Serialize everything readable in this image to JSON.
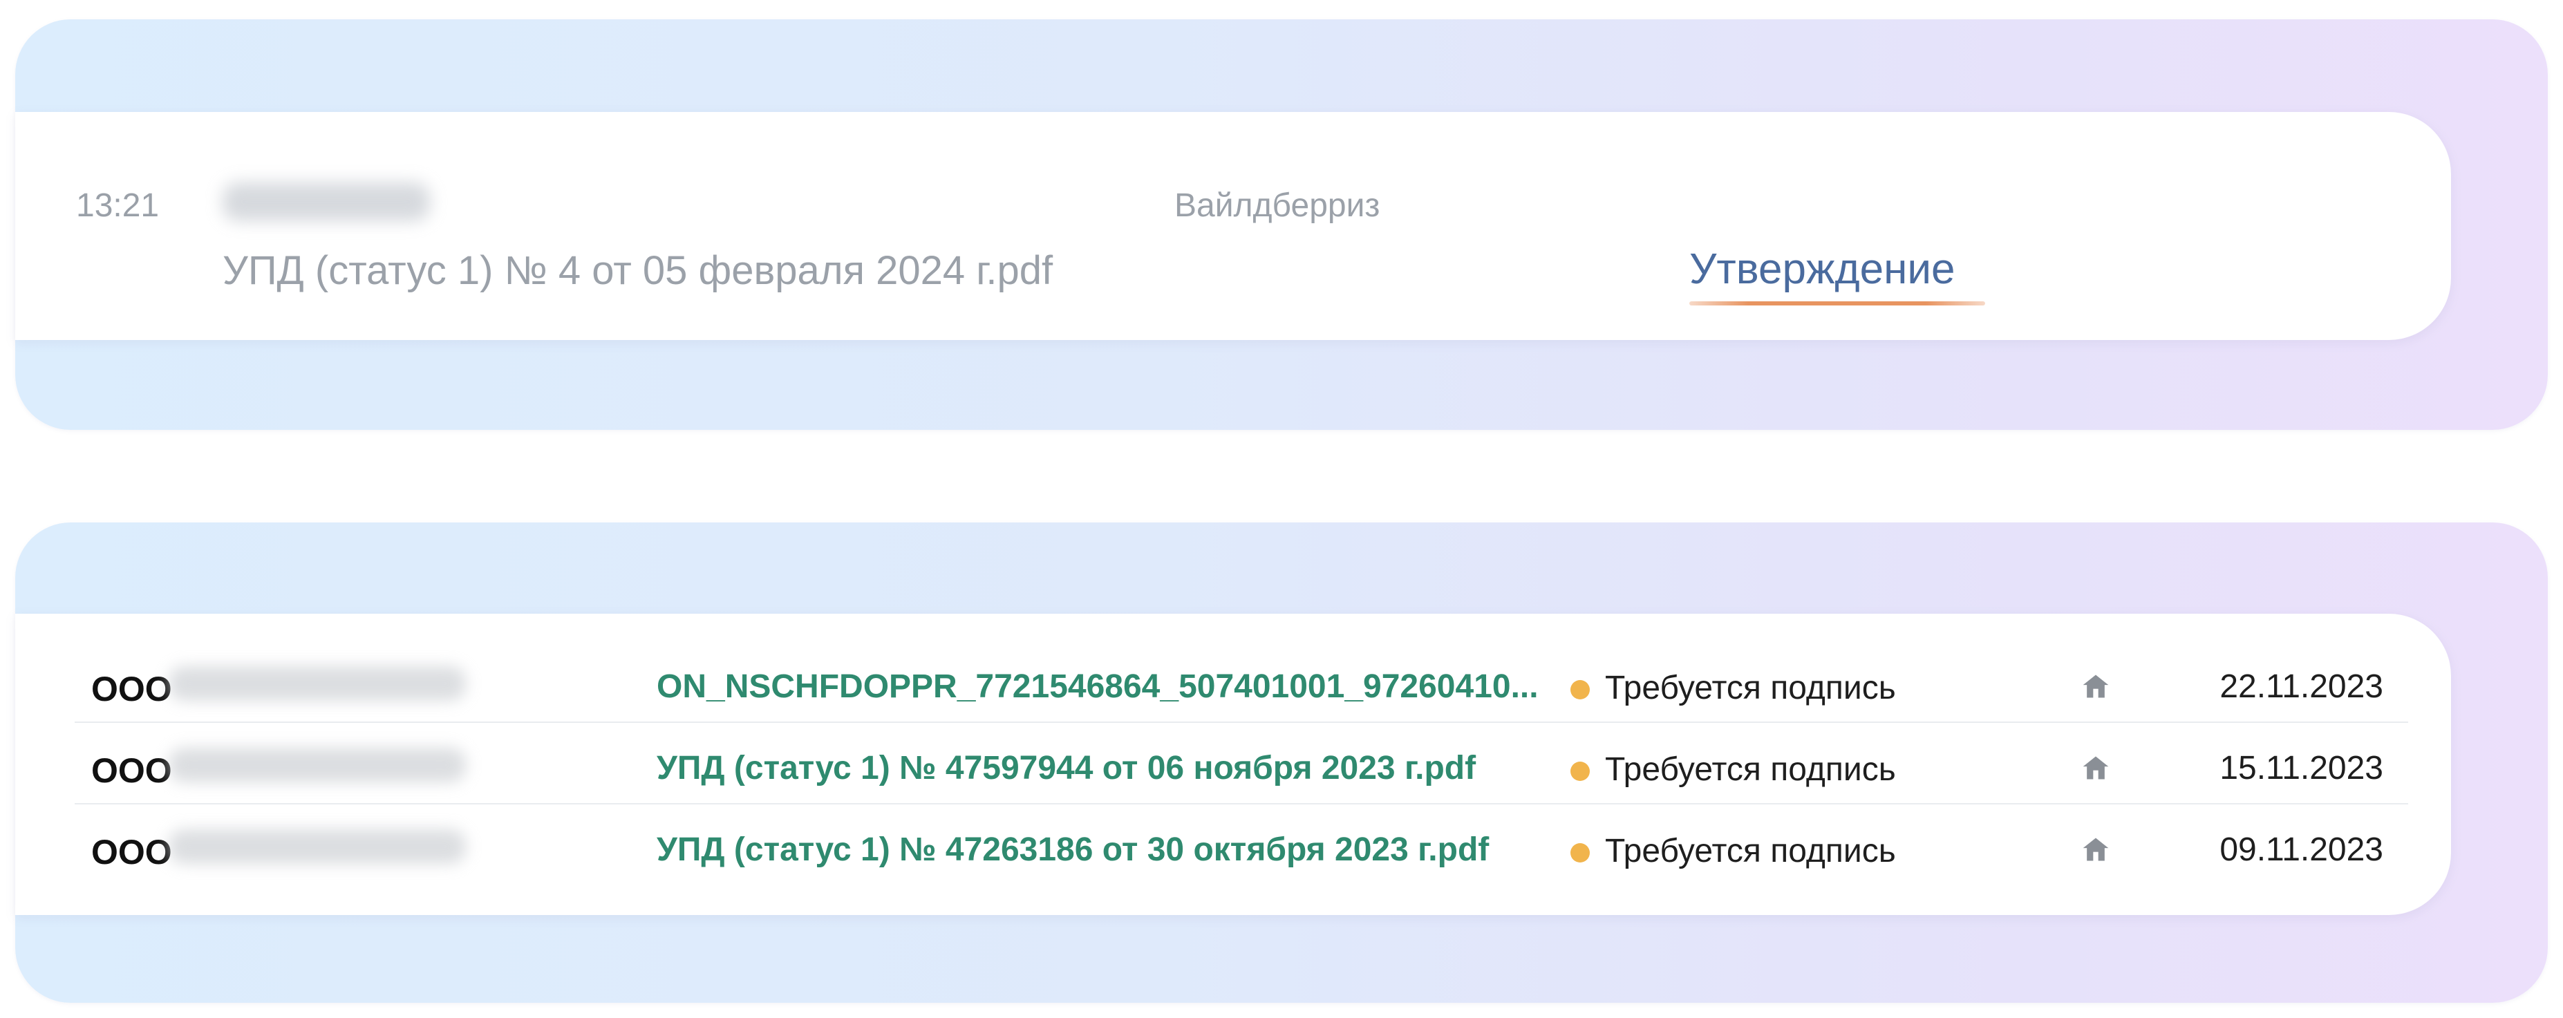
{
  "event_card": {
    "time": "13:21",
    "document": "УПД (статус 1) № 4 от 05 февраля 2024 г.pdf",
    "company": "Вайлдберриз",
    "status": "Утверждение"
  },
  "documents_table": {
    "rows": [
      {
        "org_prefix": "ООО",
        "document": "ON_NSCHFDOPPR_7721546864_507401001_97260410...",
        "status": "Требуется подпись",
        "date": "22.11.2023"
      },
      {
        "org_prefix": "ООО",
        "document": "УПД (статус 1) № 47597944 от 06 ноября 2023 г.pdf",
        "status": "Требуется подпись",
        "date": "15.11.2023"
      },
      {
        "org_prefix": "ООО",
        "document": "УПД (статус 1) № 47263186 от 30 октября 2023 г.pdf",
        "status": "Требуется подпись",
        "date": "09.11.2023"
      }
    ]
  },
  "icons": {
    "status_dot": "status-dot-icon",
    "row_icon": "home-icon"
  },
  "colors": {
    "link_green": "#2f8a6f",
    "status_blue": "#4a6b9e",
    "dot_orange": "#f1b44c",
    "underline_orange": "#e89460"
  }
}
